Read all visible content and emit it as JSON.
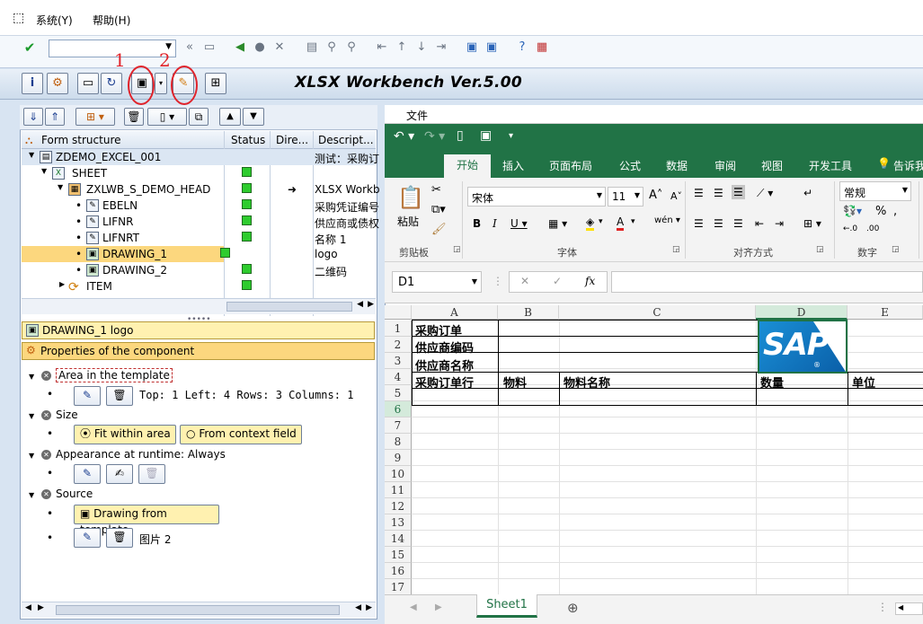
{
  "menu": {
    "system": "系统(Y)",
    "help": "帮助(H)"
  },
  "app": {
    "title": "XLSX Workbench Ver.5.00"
  },
  "annotations": {
    "one": "1",
    "two": "2"
  },
  "tree": {
    "headers": {
      "structure": "Form structure",
      "status": "Status",
      "direction": "Dire...",
      "description": "Descript..."
    },
    "rows": [
      {
        "label": "ZDEMO_EXCEL_001",
        "desc": "测试：采购订"
      },
      {
        "label": "SHEET",
        "desc": ""
      },
      {
        "label": "ZXLWB_S_DEMO_HEAD",
        "desc": "XLSX Workb"
      },
      {
        "label": "EBELN",
        "desc": "采购凭证编号"
      },
      {
        "label": "LIFNR",
        "desc": "供应商或债权"
      },
      {
        "label": "LIFNRT",
        "desc": "名称 1"
      },
      {
        "label": "DRAWING_1",
        "desc": "logo"
      },
      {
        "label": "DRAWING_2",
        "desc": "二维码"
      },
      {
        "label": "ITEM",
        "desc": ""
      }
    ]
  },
  "props": {
    "selected": "DRAWING_1  logo",
    "header": "Properties of the component",
    "area_label": "Area in the template",
    "area_value": "Top: 1 Left: 4 Rows: 3 Columns: 1",
    "size_label": "Size",
    "fit_label": "Fit within area",
    "context_label": "From context field",
    "appearance_label": "Appearance at runtime: Always",
    "source_label": "Source",
    "drawing_btn": "Drawing from template",
    "picture": "图片 2"
  },
  "excel": {
    "file_tab": "文件",
    "tabs": [
      "开始",
      "插入",
      "页面布局",
      "公式",
      "数据",
      "审阅",
      "视图",
      "开发工具",
      "告诉我"
    ],
    "paste": "粘贴",
    "font_name": "宋体",
    "font_size": "11",
    "number_format": "常规",
    "groups": {
      "clipboard": "剪贴板",
      "font": "字体",
      "alignment": "对齐方式",
      "number": "数字"
    },
    "cell_ref": "D1",
    "fx": "fx",
    "columns": [
      "A",
      "B",
      "C",
      "D",
      "E"
    ],
    "rows": [
      "1",
      "2",
      "3",
      "4",
      "5",
      "6",
      "7",
      "8",
      "9",
      "10",
      "11",
      "12",
      "13",
      "14",
      "15",
      "16",
      "17"
    ],
    "cells": {
      "a1": "采购订单",
      "a2": "供应商编码",
      "a3": "供应商名称",
      "a4": "采购订单行",
      "b4": "物料",
      "c4": "物料名称",
      "d4": "数量",
      "e4": "单位"
    },
    "logo_text": "SAP",
    "sheet_tab": "Sheet1",
    "colors": {
      "green": "#217346",
      "sap_blue": "#0a5fa8"
    }
  }
}
